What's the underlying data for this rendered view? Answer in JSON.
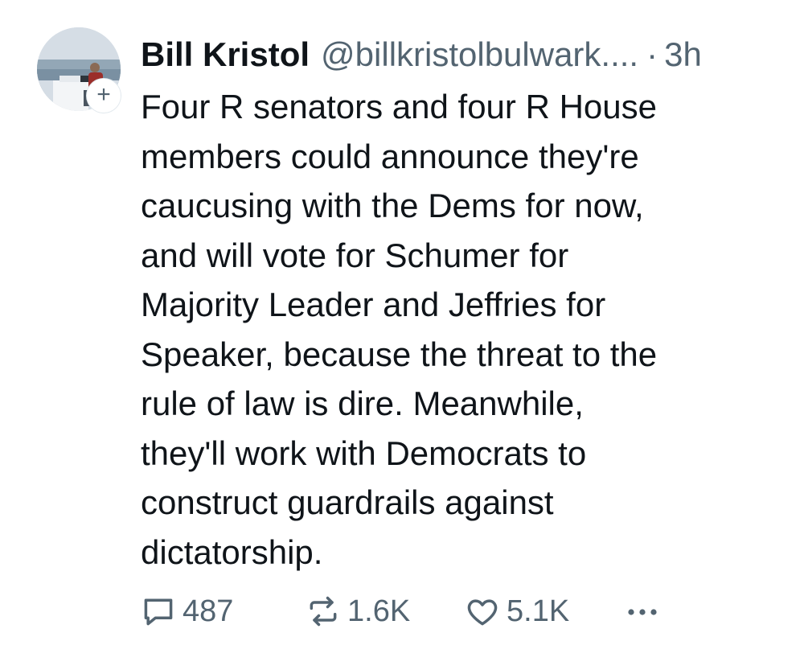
{
  "post": {
    "author": {
      "display_name": "Bill Kristol",
      "handle": "@billkristolbulwark....",
      "separator": "·",
      "timestamp": "3h",
      "follow_badge": "+"
    },
    "text": "Four R senators and four R House\nmembers could announce they're\ncaucusing with the Dems for now,\nand will vote for Schumer for\nMajority Leader and Jeffries for\nSpeaker, because the threat to the\nrule of law is dire. Meanwhile,\nthey'll work with Democrats to\nconstruct guardrails against\ndictatorship.",
    "actions": {
      "reply": {
        "icon": "reply-icon",
        "count": "487"
      },
      "repost": {
        "icon": "repost-icon",
        "count": "1.6K"
      },
      "like": {
        "icon": "heart-icon",
        "count": "5.1K"
      },
      "more": {
        "icon": "more-icon"
      }
    },
    "colors": {
      "text": "#0f1419",
      "secondary": "#536471",
      "background": "#ffffff"
    }
  }
}
